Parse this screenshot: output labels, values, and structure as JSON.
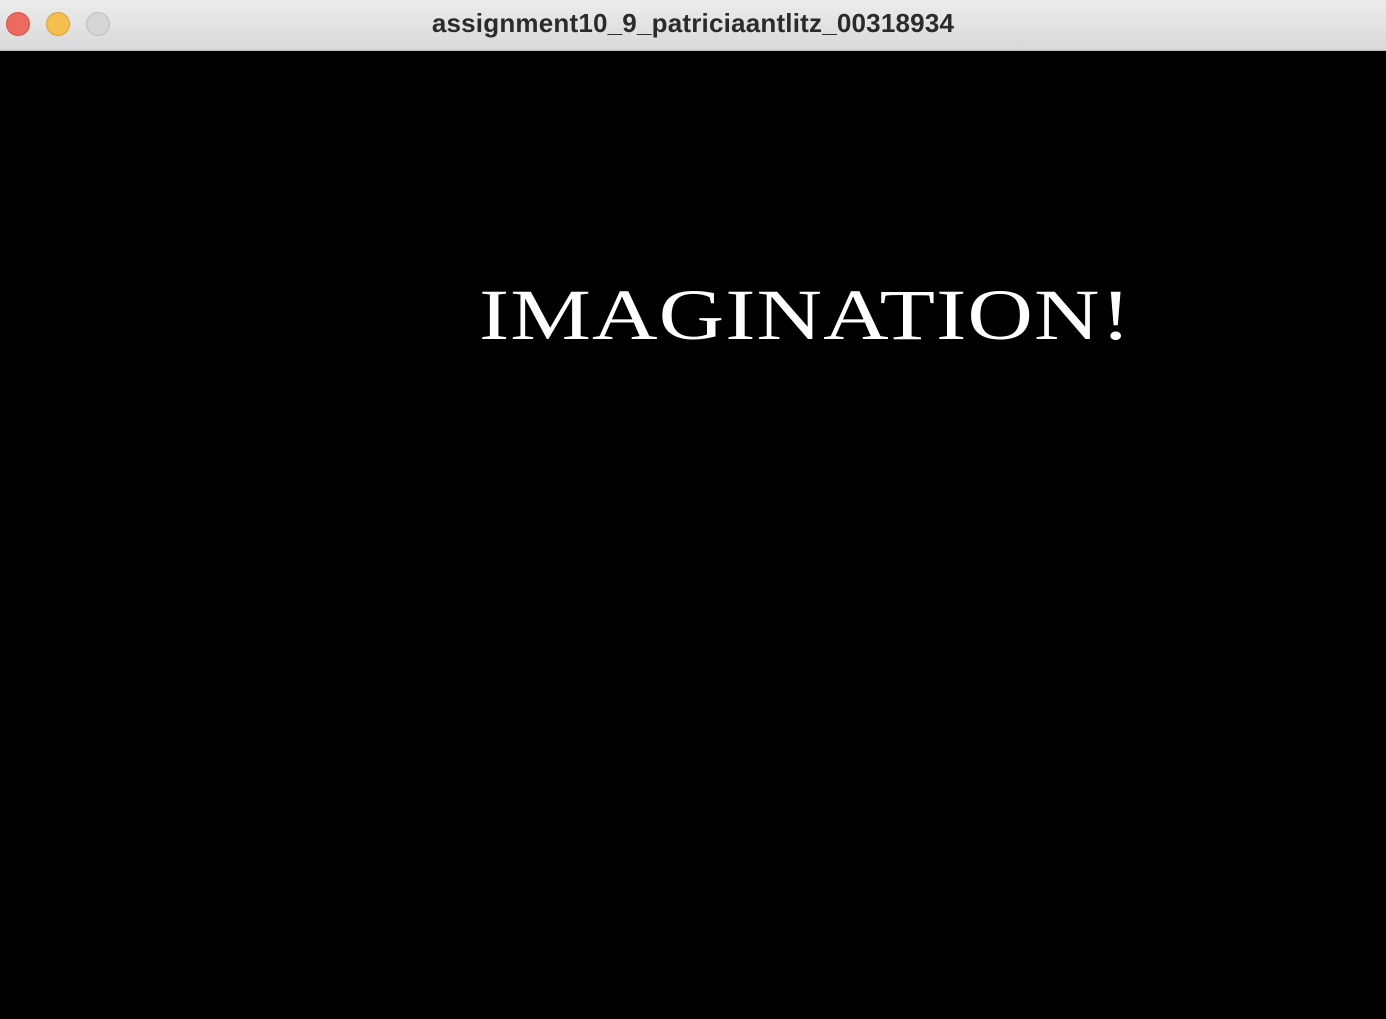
{
  "window": {
    "title": "assignment10_9_patriciaantlitz_00318934",
    "controls": {
      "close": "close-button",
      "minimize": "minimize-button",
      "zoom": "zoom-button"
    }
  },
  "canvas": {
    "background": "#000000",
    "text": "IMAGINATION!",
    "text_color": "#ffffff"
  }
}
